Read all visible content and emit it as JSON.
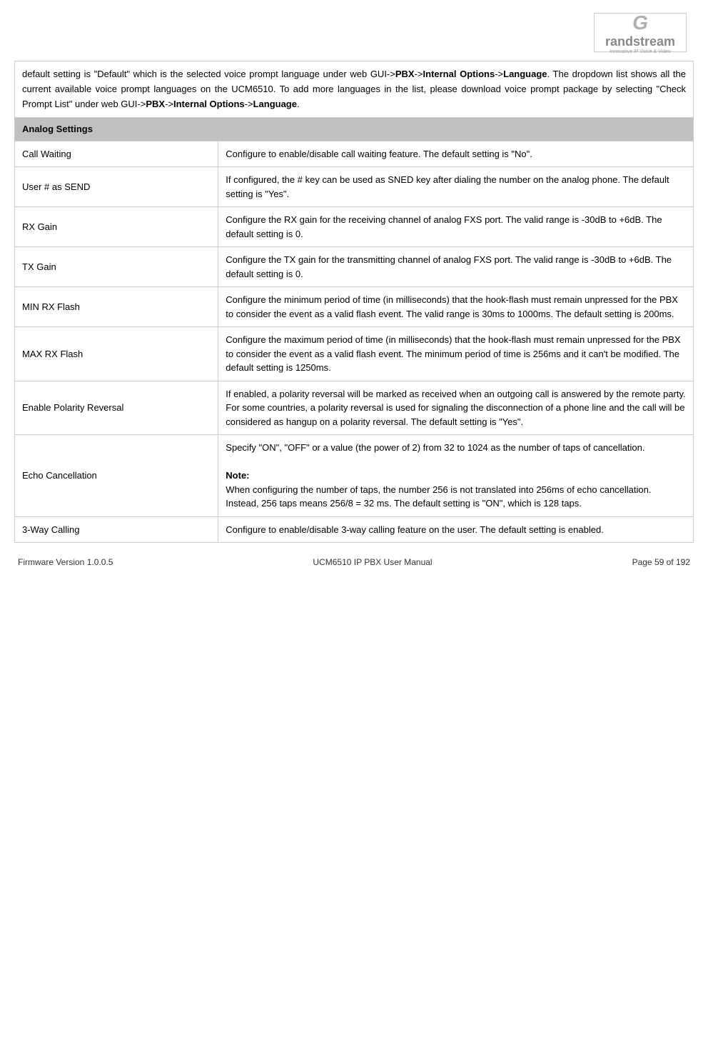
{
  "header": {
    "logo_g": "G",
    "logo_brand": "randstream",
    "logo_tagline": "Innovative IP Voice & Video"
  },
  "intro": {
    "text_part1": "default setting is \"Default\" which is the selected voice prompt language under web GUI->",
    "bold1": "PBX",
    "text_part2": "->",
    "bold2": "Internal Options",
    "text_part3": "->",
    "bold3": "Language",
    "text_part4": ". The dropdown list shows all the current available voice prompt languages on the UCM6510. To add more languages in the list, please download voice prompt package by selecting \"Check Prompt List\" under web GUI->",
    "bold4": "PBX",
    "text_part5": "->",
    "bold5": "Internal Options",
    "text_part6": "->",
    "bold6": "Language",
    "text_part7": "."
  },
  "section_header": "Analog Settings",
  "rows": [
    {
      "label": "Call Waiting",
      "desc": "Configure to enable/disable call waiting feature. The default setting is \"No\"."
    },
    {
      "label": "User # as SEND",
      "desc": "If configured, the # key can be used as SNED key after dialing the number on the analog phone. The default setting is \"Yes\"."
    },
    {
      "label": "RX Gain",
      "desc": "Configure the RX gain for the receiving channel of analog FXS port. The valid range is -30dB to +6dB. The default setting is 0."
    },
    {
      "label": "TX Gain",
      "desc": "Configure the TX gain for the transmitting channel of analog FXS port. The valid range is -30dB to +6dB. The default setting is 0."
    },
    {
      "label": "MIN RX Flash",
      "desc": "Configure the minimum period of time (in milliseconds) that the hook-flash must remain unpressed for the PBX to consider the event as a valid flash event. The valid range is 30ms to 1000ms. The default setting is 200ms."
    },
    {
      "label": "MAX RX Flash",
      "desc": "Configure the maximum period of time (in milliseconds) that the hook-flash must remain unpressed for the PBX to consider the event as a valid flash event. The minimum period of time is 256ms and it can't be modified. The default setting is 1250ms."
    },
    {
      "label": "Enable Polarity Reversal",
      "desc": "If enabled, a polarity reversal will be marked as received when an outgoing call is answered by the remote party. For some countries, a polarity reversal is used for signaling the disconnection of a phone line and the call will be considered as hangup on a polarity reversal. The default setting is \"Yes\"."
    },
    {
      "label": "Echo Cancellation",
      "desc_part1": "Specify \"ON\", \"OFF\" or a value (the power of 2) from 32 to 1024 as the number of taps of cancellation.",
      "desc_note_label": "Note:",
      "desc_note": "When configuring the number of taps, the number 256 is not translated into 256ms of echo cancellation. Instead, 256 taps means 256/8 = 32 ms. The default setting is \"ON\", which is 128 taps."
    },
    {
      "label": "3-Way Calling",
      "desc": "Configure to enable/disable 3-way calling feature on the user. The default setting is enabled."
    }
  ],
  "footer": {
    "firmware": "Firmware Version 1.0.0.5",
    "manual": "UCM6510 IP PBX User Manual",
    "page": "Page 59 of 192"
  }
}
